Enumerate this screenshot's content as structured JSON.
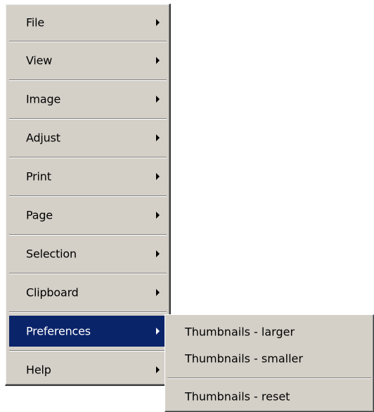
{
  "menu": {
    "items": [
      {
        "label": "File"
      },
      {
        "label": "View"
      },
      {
        "label": "Image"
      },
      {
        "label": "Adjust"
      },
      {
        "label": "Print"
      },
      {
        "label": "Page"
      },
      {
        "label": "Selection"
      },
      {
        "label": "Clipboard"
      },
      {
        "label": "Preferences",
        "selected": true
      },
      {
        "label": "Help"
      }
    ]
  },
  "submenu": {
    "items": [
      {
        "label": "Thumbnails - larger"
      },
      {
        "label": "Thumbnails - smaller"
      },
      {
        "label": "Thumbnails - reset"
      }
    ]
  },
  "colors": {
    "menu_face": "#d4d0c8",
    "highlight": "#0a246a",
    "highlight_text": "#ffffff"
  },
  "icons": {
    "submenu_arrow": "chevron-right-icon"
  }
}
